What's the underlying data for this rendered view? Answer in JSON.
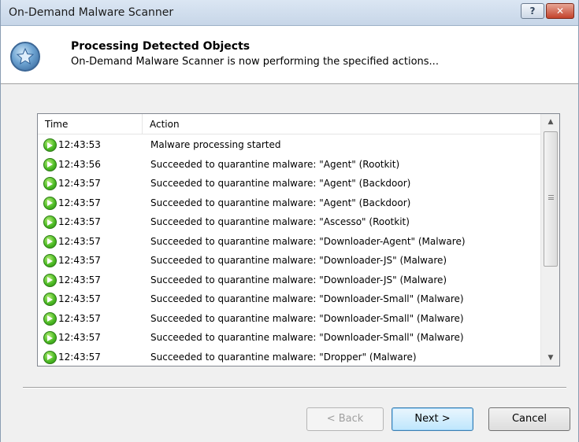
{
  "window": {
    "title": "On-Demand Malware Scanner",
    "help_label": "?",
    "close_label": "✕"
  },
  "header": {
    "title": "Processing Detected Objects",
    "subtitle": "On-Demand Malware Scanner is now performing the specified actions..."
  },
  "list": {
    "columns": {
      "time": "Time",
      "action": "Action"
    },
    "rows": [
      {
        "icon": "green-arrow-icon",
        "time": "12:43:53",
        "action": "Malware processing started"
      },
      {
        "icon": "green-arrow-icon",
        "time": "12:43:56",
        "action": "Succeeded to quarantine malware: \"Agent\" (Rootkit)"
      },
      {
        "icon": "green-arrow-icon",
        "time": "12:43:57",
        "action": "Succeeded to quarantine malware: \"Agent\" (Backdoor)"
      },
      {
        "icon": "green-arrow-icon",
        "time": "12:43:57",
        "action": "Succeeded to quarantine malware: \"Agent\" (Backdoor)"
      },
      {
        "icon": "green-arrow-icon",
        "time": "12:43:57",
        "action": "Succeeded to quarantine malware: \"Ascesso\" (Rootkit)"
      },
      {
        "icon": "green-arrow-icon",
        "time": "12:43:57",
        "action": "Succeeded to quarantine malware: \"Downloader-Agent\" (Malware)"
      },
      {
        "icon": "green-arrow-icon",
        "time": "12:43:57",
        "action": "Succeeded to quarantine malware: \"Downloader-JS\" (Malware)"
      },
      {
        "icon": "green-arrow-icon",
        "time": "12:43:57",
        "action": "Succeeded to quarantine malware: \"Downloader-JS\" (Malware)"
      },
      {
        "icon": "green-arrow-icon",
        "time": "12:43:57",
        "action": "Succeeded to quarantine malware: \"Downloader-Small\" (Malware)"
      },
      {
        "icon": "green-arrow-icon",
        "time": "12:43:57",
        "action": "Succeeded to quarantine malware: \"Downloader-Small\" (Malware)"
      },
      {
        "icon": "green-arrow-icon",
        "time": "12:43:57",
        "action": "Succeeded to quarantine malware: \"Downloader-Small\" (Malware)"
      },
      {
        "icon": "green-arrow-icon",
        "time": "12:43:57",
        "action": "Succeeded to quarantine malware: \"Dropper\" (Malware)"
      }
    ]
  },
  "buttons": {
    "back": "< Back",
    "next": "Next >",
    "cancel": "Cancel"
  },
  "colors": {
    "accent": "#3c7fb1",
    "success": "#4dbb25"
  }
}
